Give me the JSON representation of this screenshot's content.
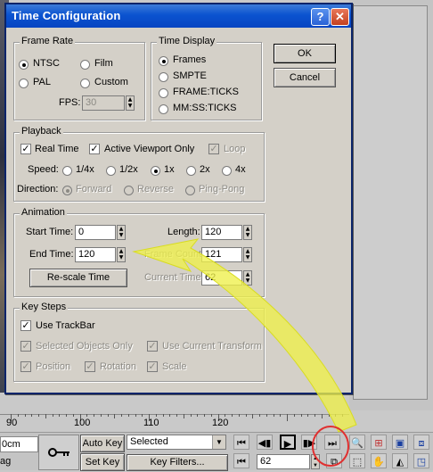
{
  "dialog": {
    "title": "Time Configuration",
    "help_label": "?",
    "close_label": "✕",
    "ok_label": "OK",
    "cancel_label": "Cancel"
  },
  "frame_rate": {
    "legend": "Frame Rate",
    "options": [
      "NTSC",
      "Film",
      "PAL",
      "Custom"
    ],
    "selected": "NTSC",
    "fps_label": "FPS:",
    "fps_value": "30"
  },
  "time_display": {
    "legend": "Time Display",
    "options": [
      "Frames",
      "SMPTE",
      "FRAME:TICKS",
      "MM:SS:TICKS"
    ],
    "selected": "Frames"
  },
  "playback": {
    "legend": "Playback",
    "real_time_label": "Real Time",
    "active_viewport_label": "Active Viewport Only",
    "loop_label": "Loop",
    "speed_label": "Speed:",
    "speeds": [
      "1/4x",
      "1/2x",
      "1x",
      "2x",
      "4x"
    ],
    "speed_selected": "1x",
    "direction_label": "Direction:",
    "directions": [
      "Forward",
      "Reverse",
      "Ping-Pong"
    ]
  },
  "animation": {
    "legend": "Animation",
    "start_time_label": "Start Time:",
    "start_time": "0",
    "end_time_label": "End Time:",
    "end_time": "120",
    "length_label": "Length:",
    "length": "120",
    "frame_count_label": "Frame Count:",
    "frame_count": "121",
    "current_time_label": "Current Time:",
    "current_time": "62",
    "rescale_label": "Re-scale Time"
  },
  "key_steps": {
    "legend": "Key Steps",
    "use_trackbar_label": "Use TrackBar",
    "selected_objects_label": "Selected Objects Only",
    "use_current_transform_label": "Use Current Transform",
    "position_label": "Position",
    "rotation_label": "Rotation",
    "scale_label": "Scale"
  },
  "ruler": {
    "labels": [
      "90",
      "100",
      "110",
      "120"
    ]
  },
  "bottom": {
    "left_label_1": "0cm",
    "left_label_2": "ag",
    "auto_key_label": "Auto Key",
    "set_key_label": "Set Key",
    "selected_dropdown": "Selected",
    "key_filters_label": "Key Filters...",
    "current_frame": "62"
  },
  "colors": {
    "title_blue": "#0b53d0",
    "dialog_bg": "#d4d0c8",
    "arrow_yellow": "#eef04a",
    "highlight_circle": "#e03030"
  }
}
